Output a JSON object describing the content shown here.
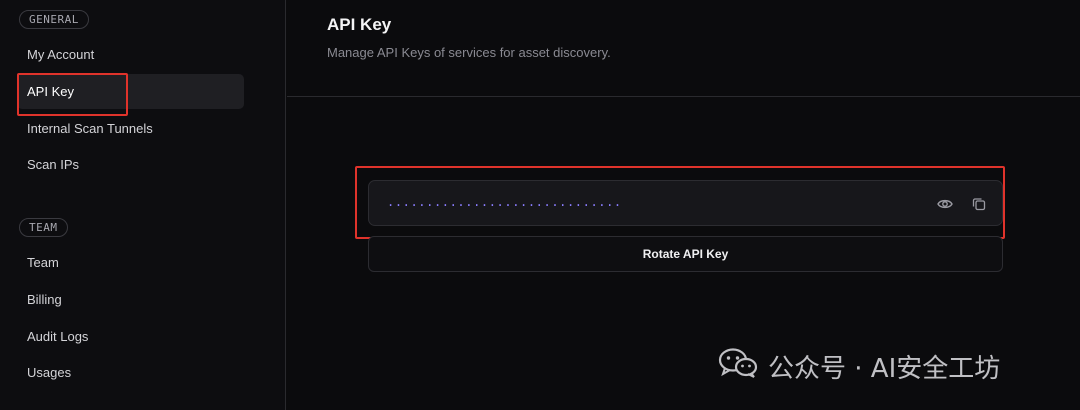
{
  "sidebar": {
    "general_label": "GENERAL",
    "team_label": "TEAM",
    "general_items": [
      {
        "label": "My Account"
      },
      {
        "label": "API Key"
      },
      {
        "label": "Internal Scan Tunnels"
      },
      {
        "label": "Scan IPs"
      }
    ],
    "team_items": [
      {
        "label": "Team"
      },
      {
        "label": "Billing"
      },
      {
        "label": "Audit Logs"
      },
      {
        "label": "Usages"
      }
    ],
    "active_item": "API Key"
  },
  "main": {
    "title": "API Key",
    "subtitle": "Manage API Keys of services for asset discovery.",
    "api_key_masked": "..............................",
    "reveal_icon": "eye-icon",
    "copy_icon": "copy-icon",
    "rotate_button_label": "Rotate API Key"
  },
  "watermark": {
    "text": "公众号 · AI安全工坊",
    "icon": "wechat-icon"
  },
  "colors": {
    "background": "#0b0b0d",
    "active_item_bg": "#1f1f23",
    "highlight_red": "#e0332b",
    "key_dots": "#8a7dff"
  }
}
